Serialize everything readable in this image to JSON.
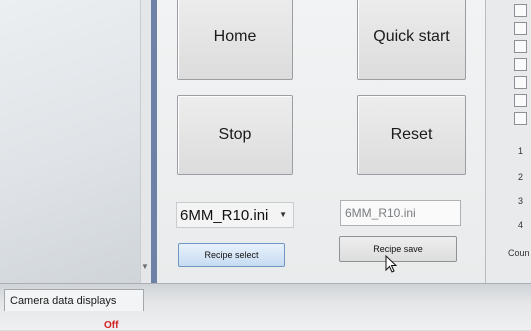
{
  "buttons": {
    "home": "Home",
    "quick_start": "Quick start",
    "stop": "Stop",
    "reset": "Reset",
    "recipe_select": "Recipe select",
    "recipe_save": "Recipe save"
  },
  "recipe": {
    "combo_value": "6MM_R10.ini",
    "save_name": "6MM_R10.ini"
  },
  "right_panel": {
    "numbers": [
      "1",
      "2",
      "3",
      "4"
    ],
    "count_label": "Coun"
  },
  "tabs": {
    "camera_data_displays": "Camera data displays"
  },
  "status": {
    "off_text": "Off"
  },
  "colors": {
    "divider": "#6d82a6",
    "selected_button": "#c7dcf2",
    "off_text": "#d22020"
  }
}
